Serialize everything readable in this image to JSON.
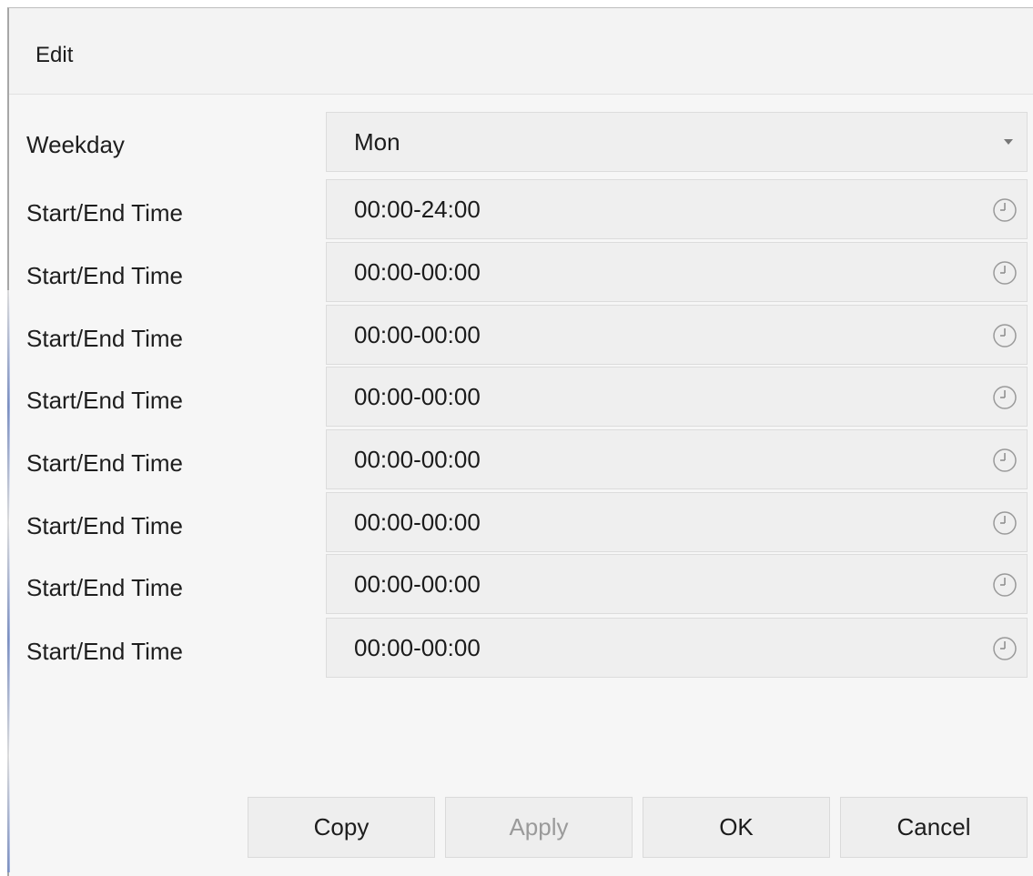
{
  "dialog": {
    "title": "Edit"
  },
  "weekday": {
    "label": "Weekday",
    "value": "Mon"
  },
  "time_rows": [
    {
      "label": "Start/End Time",
      "value": "00:00-24:00"
    },
    {
      "label": "Start/End Time",
      "value": "00:00-00:00"
    },
    {
      "label": "Start/End Time",
      "value": "00:00-00:00"
    },
    {
      "label": "Start/End Time",
      "value": "00:00-00:00"
    },
    {
      "label": "Start/End Time",
      "value": "00:00-00:00"
    },
    {
      "label": "Start/End Time",
      "value": "00:00-00:00"
    },
    {
      "label": "Start/End Time",
      "value": "00:00-00:00"
    },
    {
      "label": "Start/End Time",
      "value": "00:00-00:00"
    }
  ],
  "buttons": {
    "copy": "Copy",
    "apply": "Apply",
    "ok": "OK",
    "cancel": "Cancel"
  },
  "icons": {
    "dropdown": "chevron-down-icon",
    "time_picker": "clock-icon"
  },
  "colors": {
    "dialog_bg": "#f6f6f6",
    "field_bg": "#efefef",
    "disabled_text": "#9a9a9a"
  }
}
